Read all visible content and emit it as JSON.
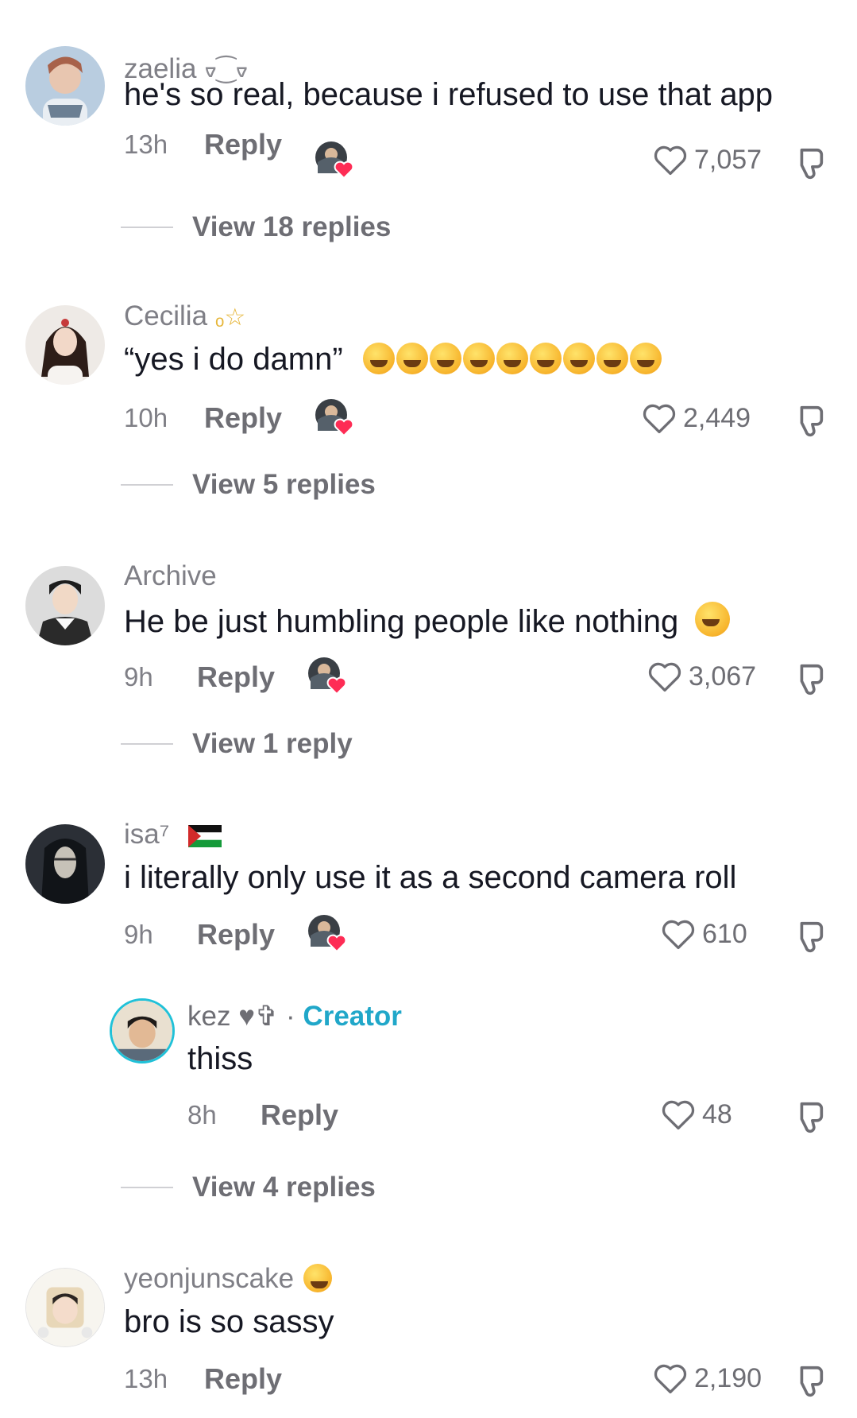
{
  "comments": [
    {
      "username": "zaelia",
      "username_deco": "ᢦ⁐ᢦ",
      "text": "he's so real, because i refused to use that app",
      "time": "13h",
      "reply_label": "Reply",
      "likes": "7,057",
      "view_replies": "View 18 replies"
    },
    {
      "username": "Cecilia",
      "username_deco": "ₒ☆",
      "text": "“yes i do damn”",
      "emoji_count": 9,
      "time": "10h",
      "reply_label": "Reply",
      "likes": "2,449",
      "view_replies": "View 5 replies"
    },
    {
      "username": "Archive",
      "text": "He be just humbling people like nothing",
      "time": "9h",
      "reply_label": "Reply",
      "likes": "3,067",
      "view_replies": "View 1 reply"
    },
    {
      "username": "isa⁷",
      "text": "i literally only use it as a second camera roll",
      "time": "9h",
      "reply_label": "Reply",
      "likes": "610",
      "reply": {
        "username": "kez ♥✞",
        "separator": "·",
        "creator_label": "Creator",
        "text": "thiss",
        "time": "8h",
        "reply_label": "Reply",
        "likes": "48"
      },
      "view_replies": "View 4 replies"
    },
    {
      "username": "yeonjunscake",
      "text": "bro is so sassy",
      "time": "13h",
      "reply_label": "Reply",
      "likes": "2,190"
    }
  ],
  "colors": {
    "primary_text": "#161823",
    "secondary_text": "#7f7f86",
    "creator_accent": "#20a7c9",
    "creator_heart": "#fe2c55"
  },
  "icons": [
    "heart-outline-icon",
    "dislike-icon",
    "creator-liked-icon"
  ]
}
